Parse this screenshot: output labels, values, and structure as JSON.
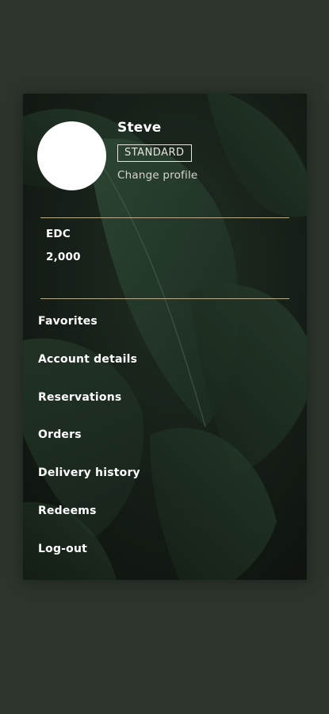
{
  "profile": {
    "name": "Steve",
    "tier": "STANDARD",
    "change_profile_label": "Change profile"
  },
  "points": {
    "label": "EDC",
    "value": "2,000"
  },
  "menu": {
    "items": [
      {
        "label": "Favorites"
      },
      {
        "label": "Account details"
      },
      {
        "label": "Reservations"
      },
      {
        "label": "Orders"
      },
      {
        "label": "Delivery history"
      },
      {
        "label": "Redeems"
      },
      {
        "label": "Log-out"
      }
    ]
  },
  "colors": {
    "page_background": "#2c342c",
    "panel_background": "#141a14",
    "leaf_green": "#2f4a38",
    "divider": "#b8ae8e",
    "text": "#ffffff"
  }
}
